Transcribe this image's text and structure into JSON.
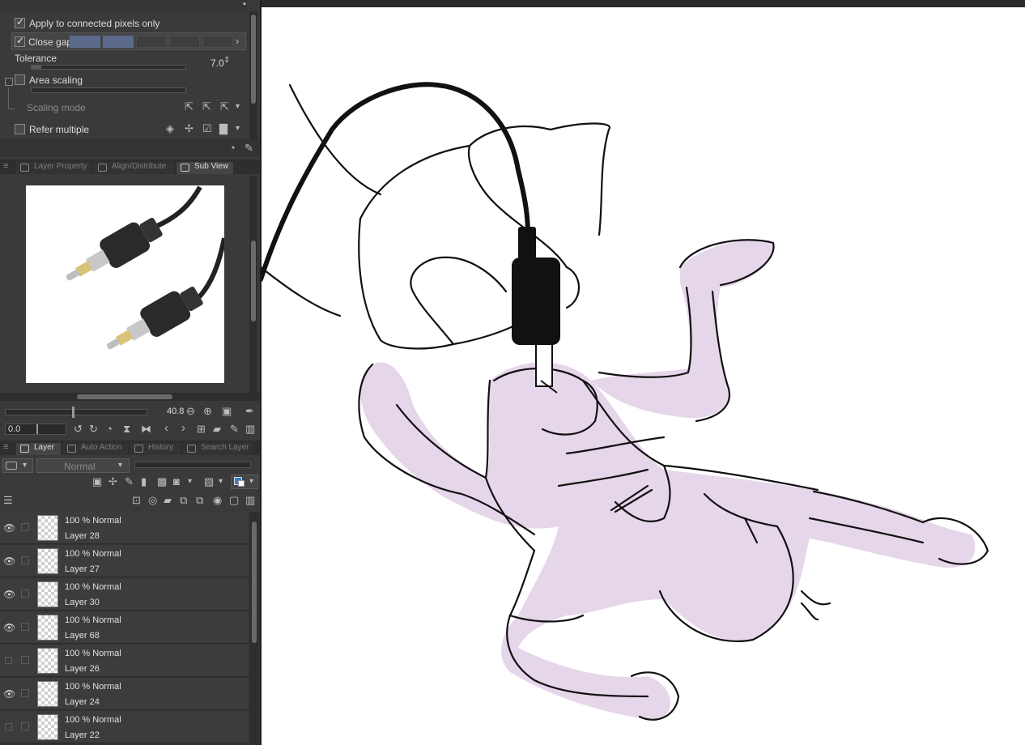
{
  "tool_property": {
    "apply_connected": "Apply to connected pixels only",
    "close_gap": "Close gap",
    "tolerance_label": "Tolerance",
    "tolerance_value": "7.0",
    "area_scaling": "Area scaling",
    "scaling_mode": "Scaling mode",
    "refer_multiple": "Refer multiple"
  },
  "sub_tabs": [
    {
      "label": "Layer Property"
    },
    {
      "label": "Align/Distribute"
    },
    {
      "label": "Sub View"
    }
  ],
  "subview": {
    "zoom_value": "40.8",
    "rotate_value": "0.0"
  },
  "layer_tabs": [
    {
      "label": "Layer"
    },
    {
      "label": "Auto Action"
    },
    {
      "label": "History"
    },
    {
      "label": "Search Layer"
    }
  ],
  "layer_panel": {
    "blend_mode": "Normal",
    "layers": [
      {
        "mode": "100 % Normal",
        "name": "Layer 28",
        "visible": true
      },
      {
        "mode": "100 % Normal",
        "name": "Layer 27",
        "visible": true
      },
      {
        "mode": "100 % Normal",
        "name": "Layer 30",
        "visible": true
      },
      {
        "mode": "100 % Normal",
        "name": "Layer 68",
        "visible": true
      },
      {
        "mode": "100 % Normal",
        "name": "Layer 26",
        "visible": false
      },
      {
        "mode": "100 % Normal",
        "name": "Layer 24",
        "visible": true
      },
      {
        "mode": "100 % Normal",
        "name": "Layer 22",
        "visible": false
      }
    ]
  },
  "icons": {
    "eye": "eye-icon",
    "check": "check-icon"
  },
  "colors": {
    "panel_bg": "#3a3a3a",
    "accent_slider": "#5c6a8c",
    "fill_lavender": "#e6d6ea"
  }
}
